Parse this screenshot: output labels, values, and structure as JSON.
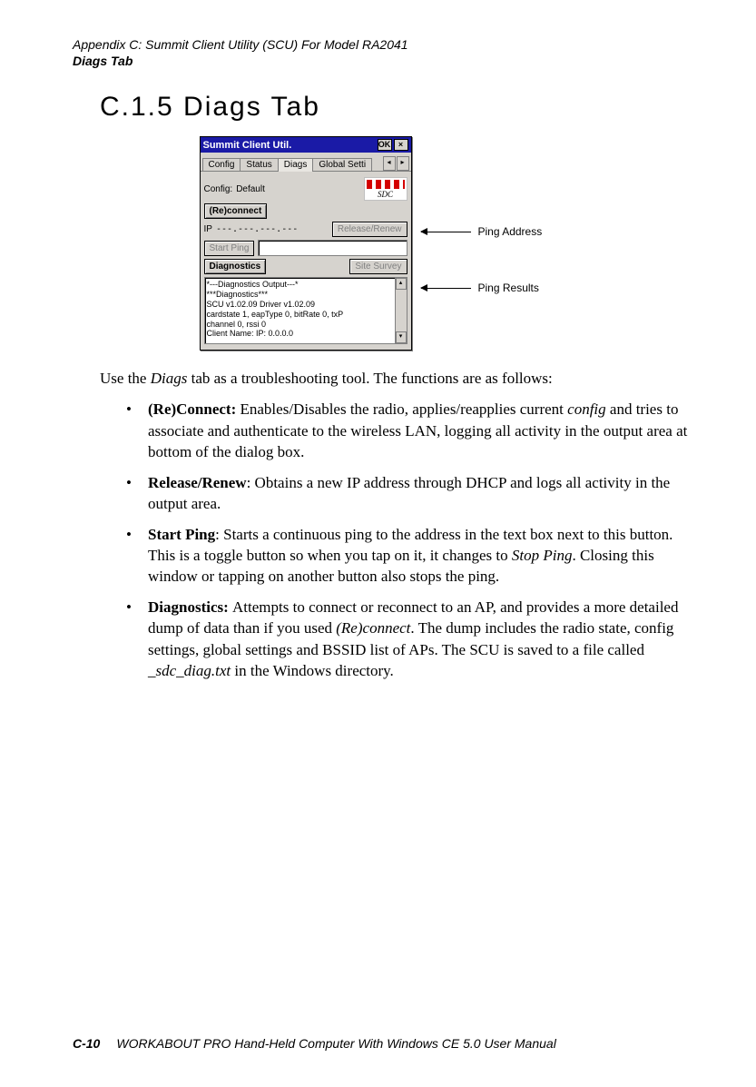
{
  "header": {
    "line1": "Appendix  C:  Summit Client Utility (SCU) For Model RA2041",
    "line2": "Diags Tab"
  },
  "heading": "C.1.5   Diags Tab",
  "dialog": {
    "title": "Summit Client Util.",
    "ok": "OK",
    "close": "×",
    "tabs": {
      "t1": "Config",
      "t2": "Status",
      "t3": "Diags",
      "t4": "Global Setti"
    },
    "nav": {
      "left": "◂",
      "right": "▸"
    },
    "configLabel": "Config:",
    "configValue": "Default",
    "logoText": "SDC",
    "reconnect": "(Re)connect",
    "ipLabel": "IP",
    "ipValue": "---.---.---.---",
    "releaseRenew": "Release/Renew",
    "startPing": "Start Ping",
    "pingInput": "",
    "diagnostics": "Diagnostics",
    "siteSurvey": "Site Survey",
    "outputLines": {
      "l1": "*---Diagnostics Output---*",
      "l2": "***Diagnostics***",
      "l3": "SCU v1.02.09 Driver v1.02.09",
      "l4": "cardstate 1, eapType 0, bitRate 0, txP",
      "l5": "channel 0, rssi 0",
      "l6": "Client Name: IP: 0.0.0.0"
    },
    "sbUp": "▴",
    "sbDown": "▾"
  },
  "annotations": {
    "pingAddress": "Ping Address",
    "pingResults": "Ping Results"
  },
  "intro": "Use the Diags tab as a troubleshooting tool. The functions are as follows:",
  "bullets": {
    "b1": {
      "lead": "(Re)Connect: ",
      "rest_a": "Enables/Disables the radio, applies/reapplies current ",
      "ital": "config",
      "rest_b": " and tries to associate and authenticate to the wireless LAN, logging all activity in the output area at bottom of the dialog box."
    },
    "b2": {
      "lead": "Release/Renew",
      "rest": ": Obtains a new IP address through DHCP and logs all activity in the output area."
    },
    "b3": {
      "lead": "Start Ping",
      "rest_a": ": Starts a continuous ping to the address in the text box next to this button. This is a toggle button so when you tap on it, it changes to ",
      "ital": "Stop Ping",
      "rest_b": ". Closing this window or tapping on another button also stops the ping."
    },
    "b4": {
      "lead": "Diagnostics: ",
      "rest_a": "Attempts to connect or reconnect to an AP, and provides a more detailed dump of data than if you used ",
      "ital1": "(Re)connect",
      "rest_b": ". The dump includes the radio state, config settings, global settings and BSSID list of APs. The SCU is saved to a file called ",
      "ital2": "_sdc_diag.txt",
      "rest_c": " in the Windows directory."
    }
  },
  "footer": {
    "page": "C-10",
    "title": "WORKABOUT PRO Hand-Held Computer With Windows CE 5.0 User Manual"
  }
}
